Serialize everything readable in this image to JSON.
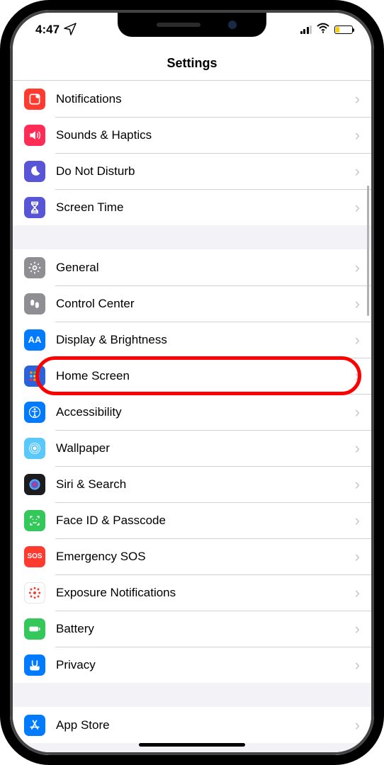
{
  "status": {
    "time": "4:47"
  },
  "header": {
    "title": "Settings"
  },
  "groups": [
    {
      "rows": [
        {
          "label": "Notifications"
        },
        {
          "label": "Sounds & Haptics"
        },
        {
          "label": "Do Not Disturb"
        },
        {
          "label": "Screen Time"
        }
      ]
    },
    {
      "rows": [
        {
          "label": "General"
        },
        {
          "label": "Control Center"
        },
        {
          "label": "Display & Brightness"
        },
        {
          "label": "Home Screen"
        },
        {
          "label": "Accessibility"
        },
        {
          "label": "Wallpaper"
        },
        {
          "label": "Siri & Search"
        },
        {
          "label": "Face ID & Passcode"
        },
        {
          "label": "Emergency SOS"
        },
        {
          "label": "Exposure Notifications"
        },
        {
          "label": "Battery"
        },
        {
          "label": "Privacy"
        }
      ]
    },
    {
      "rows": [
        {
          "label": "App Store"
        }
      ]
    }
  ],
  "highlighted_row": "Home Screen"
}
